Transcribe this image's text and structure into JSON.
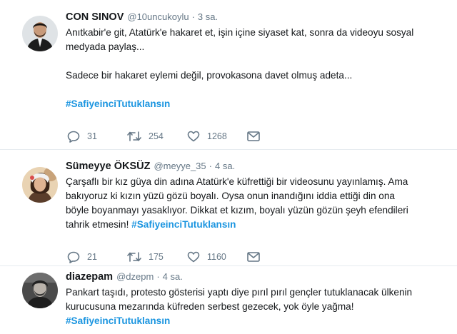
{
  "tweets": [
    {
      "name": "CON SINOV",
      "handle": "@10uncukoylu",
      "time": "3 sa.",
      "lines": [
        "Anıtkabir'e git, Atatürk'e hakaret et, işin içine siyaset kat, sonra da videoyu sosyal",
        "medyada paylaş...",
        "",
        "Sadece bir hakaret eylemi değil, provokasona davet olmuş adeta...",
        ""
      ],
      "hashtag": "#SafiyeinciTutuklansın",
      "replies": "31",
      "retweets": "254",
      "likes": "1268"
    },
    {
      "name": "Sümeyye ÖKSÜZ",
      "handle": "@meyye_35",
      "time": "4 sa.",
      "lines": [
        "Çarşaflı bir kız güya din adına Atatürk'e küfrettiği bir videosunu yayınlamış. Ama",
        "bakıyoruz ki kızın yüzü gözü boyalı. Oysa onun inandığını iddia ettiği din ona",
        "böyle boyanmayı yasaklıyor. Dikkat et kızım, boyalı yüzün gözün şeyh efendileri"
      ],
      "last_line": "tahrik etmesin! ",
      "hashtag": "#SafiyeinciTutuklansın",
      "replies": "21",
      "retweets": "175",
      "likes": "1160"
    },
    {
      "name": "diazepam",
      "handle": "@dzepm",
      "time": "4 sa.",
      "lines": [
        "Pankart taşıdı, protesto gösterisi yaptı diye pırıl pırıl gençler tutuklanacak ülkenin",
        "kurucusuna mezarında küfreden serbest gezecek, yok öyle yağma!"
      ],
      "hashtag": "#SafiyeinciTutuklansın"
    }
  ],
  "colors": {
    "hashtag": "#1b95e0",
    "muted": "#657786",
    "divider": "#e6ecf0"
  },
  "icons": [
    "reply-icon",
    "retweet-icon",
    "like-icon",
    "direct-message-icon"
  ]
}
